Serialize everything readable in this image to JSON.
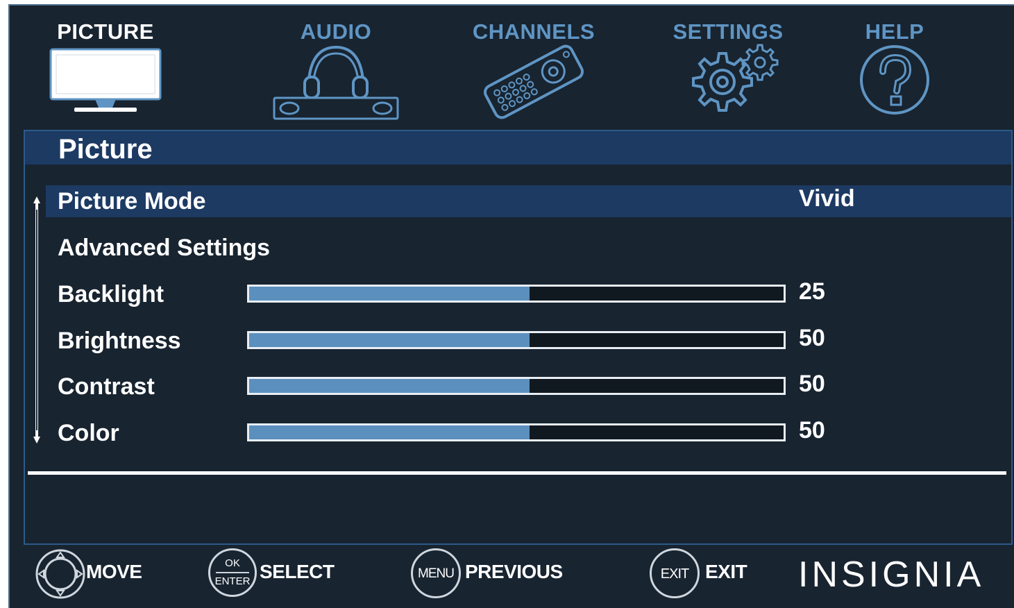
{
  "tabs": [
    {
      "label": "PICTURE",
      "icon": "tv-icon",
      "active": true
    },
    {
      "label": "AUDIO",
      "icon": "headphones-soundbar-icon",
      "active": false
    },
    {
      "label": "CHANNELS",
      "icon": "remote-control-icon",
      "active": false
    },
    {
      "label": "SETTINGS",
      "icon": "gears-icon",
      "active": false
    },
    {
      "label": "HELP",
      "icon": "question-mark-icon",
      "active": false
    }
  ],
  "panel": {
    "title": "Picture",
    "items": [
      {
        "label": "Picture Mode",
        "value": "Vivid",
        "selected": true
      },
      {
        "label": "Advanced Settings"
      },
      {
        "label": "Backlight",
        "value": "25",
        "fill": 0.525
      },
      {
        "label": "Brightness",
        "value": "50",
        "fill": 0.525
      },
      {
        "label": "Contrast",
        "value": "50",
        "fill": 0.525
      },
      {
        "label": "Color",
        "value": "50",
        "fill": 0.525
      }
    ]
  },
  "footer": {
    "hints": [
      {
        "button": "",
        "label": "MOVE",
        "icon": "dpad-icon"
      },
      {
        "button_top": "OK",
        "button_bottom": "ENTER",
        "label": "SELECT",
        "icon": "ok-enter-button-icon"
      },
      {
        "button": "MENU",
        "label": "PREVIOUS",
        "icon": "menu-button-icon"
      },
      {
        "button": "EXIT",
        "label": "EXIT",
        "icon": "exit-button-icon"
      }
    ],
    "brand": "INSIGNIA"
  },
  "colors": {
    "background": "#182430",
    "header_bar": "#1d3a63",
    "accent": "#5f95c4",
    "slider_fill": "#5b8fbd",
    "text": "#ffffff"
  }
}
